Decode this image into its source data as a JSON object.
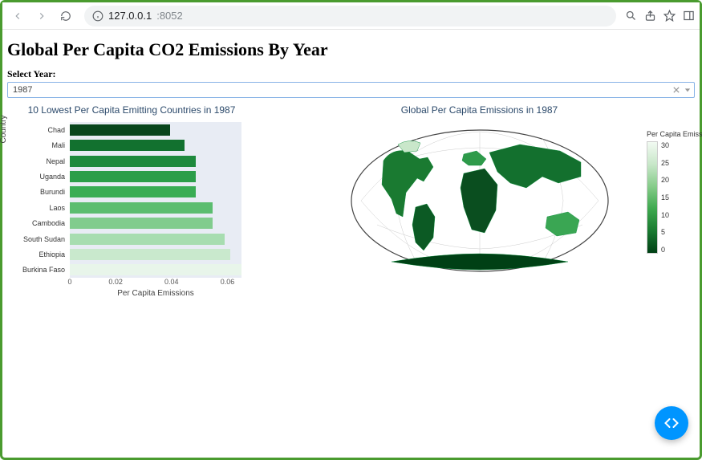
{
  "browser": {
    "url_host": "127.0.0.1",
    "url_port": ":8052"
  },
  "page": {
    "heading": "Global Per Capita CO2 Emissions By Year",
    "select_label": "Select Year:",
    "selected_year": "1987"
  },
  "chart_data": {
    "bar_chart": {
      "type": "bar",
      "title": "10 Lowest Per Capita Emitting Countries in 1987",
      "xlabel": "Per Capita Emissions",
      "ylabel": "Country",
      "xlim": [
        0,
        0.06
      ],
      "xticks": [
        0,
        0.02,
        0.04,
        0.06
      ],
      "categories": [
        "Chad",
        "Mali",
        "Nepal",
        "Uganda",
        "Burundi",
        "Laos",
        "Cambodia",
        "South Sudan",
        "Ethiopia",
        "Burkina Faso"
      ],
      "values": [
        0.035,
        0.04,
        0.044,
        0.044,
        0.044,
        0.05,
        0.05,
        0.054,
        0.056,
        0.06
      ],
      "colors": [
        "#08451c",
        "#12712f",
        "#1e8a3d",
        "#2b9e49",
        "#39ad54",
        "#5bbd6f",
        "#81cc8d",
        "#a7ddb0",
        "#c9e9cd",
        "#e8f5ea"
      ]
    },
    "map": {
      "type": "choropleth",
      "title": "Global Per Capita Emissions in 1987",
      "legend_title": "Per Capita Emissions",
      "colorbar_range": [
        0,
        30
      ],
      "colorbar_ticks": [
        30,
        25,
        20,
        15,
        10,
        5,
        0
      ]
    }
  }
}
